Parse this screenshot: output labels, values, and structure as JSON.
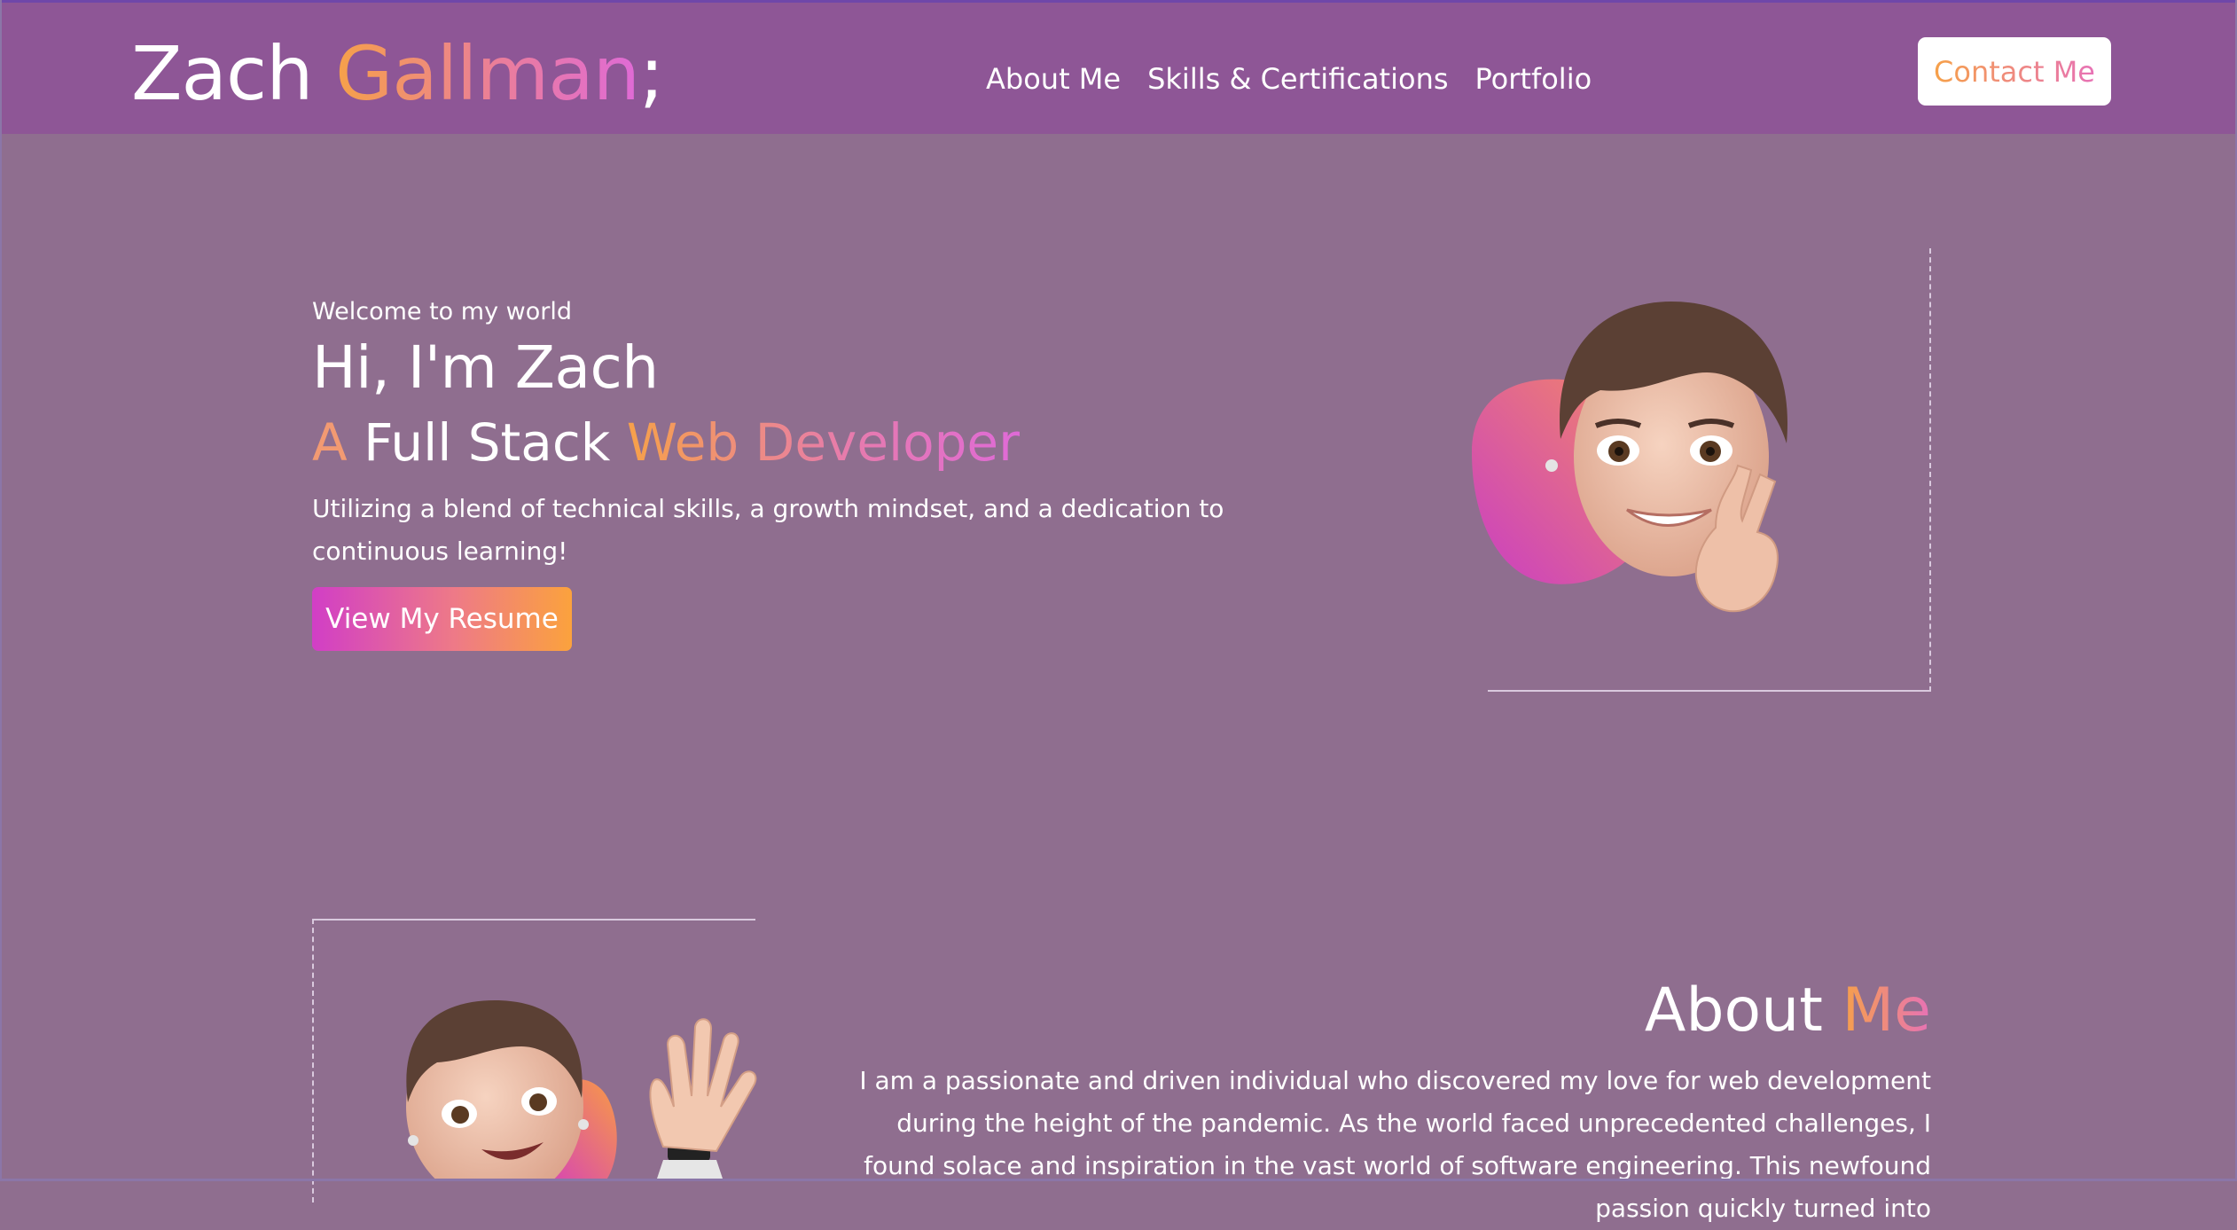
{
  "header": {
    "brand": {
      "first_name": "Zach ",
      "last_name": "Gallman",
      "suffix": ";"
    },
    "nav": [
      {
        "label": "About Me"
      },
      {
        "label": "Skills & Certifications"
      },
      {
        "label": "Portfolio"
      }
    ],
    "contact_label": "Contact Me"
  },
  "hero": {
    "welcome": "Welcome to my world",
    "greeting": "Hi, I'm Zach",
    "role": {
      "prefix": "A",
      "middle": " Full Stack ",
      "highlight": "Web Developer"
    },
    "description": "Utilizing a blend of technical skills, a growth mindset, and a dedication to continuous learning!",
    "resume_label": "View My Resume"
  },
  "about": {
    "title": "About ",
    "title_accent": "Me",
    "body": "I am a passionate and driven individual who discovered my love for web development during the height of the pandemic. As the world faced unprecedented challenges, I found solace and inspiration in the vast world of software engineering. This newfound passion quickly turned into"
  },
  "colors": {
    "background": "#8f6e8f",
    "header": "#8e5696",
    "accent_orange": "#f6a149",
    "accent_pink": "#df6ad7"
  },
  "icons": {
    "hero_avatar": "peace-sign-memoji-icon",
    "about_avatar": "waving-memoji-icon"
  }
}
